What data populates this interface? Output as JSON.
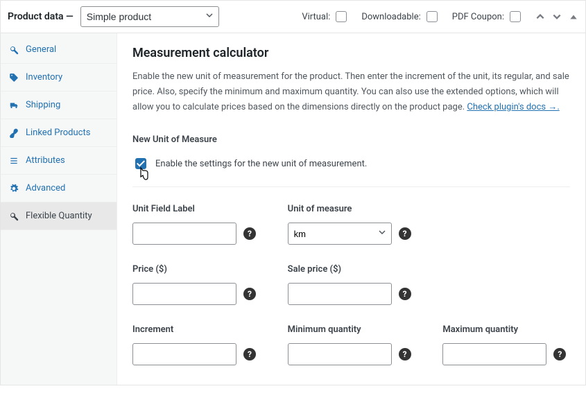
{
  "header": {
    "title": "Product data —",
    "product_type": "Simple product",
    "virtual": "Virtual:",
    "downloadable": "Downloadable:",
    "pdf_coupon": "PDF Coupon:"
  },
  "tabs": {
    "general": "General",
    "inventory": "Inventory",
    "shipping": "Shipping",
    "linked": "Linked Products",
    "attributes": "Attributes",
    "advanced": "Advanced",
    "flexible_quantity": "Flexible Quantity"
  },
  "content": {
    "heading": "Measurement calculator",
    "description": "Enable the new unit of measurement for the product. Then enter the increment of the unit, its regular, and sale price. Also, specify the minimum and maximum quantity. You can also use the extended options, which will allow you to calculate prices based on the dimensions directly on the product page. ",
    "docs_link": "Check plugin's docs →.",
    "subheading": "New Unit of Measure",
    "enable_label": "Enable the settings for the new unit of measurement.",
    "enable_checked": true,
    "fields": {
      "unit_label": {
        "label": "Unit Field Label",
        "value": ""
      },
      "unit_measure": {
        "label": "Unit of measure",
        "value": "km"
      },
      "price": {
        "label": "Price ($)",
        "value": ""
      },
      "sale_price": {
        "label": "Sale price ($)",
        "value": ""
      },
      "increment": {
        "label": "Increment",
        "value": ""
      },
      "min_qty": {
        "label": "Minimum quantity",
        "value": ""
      },
      "max_qty": {
        "label": "Maximum quantity",
        "value": ""
      }
    }
  }
}
